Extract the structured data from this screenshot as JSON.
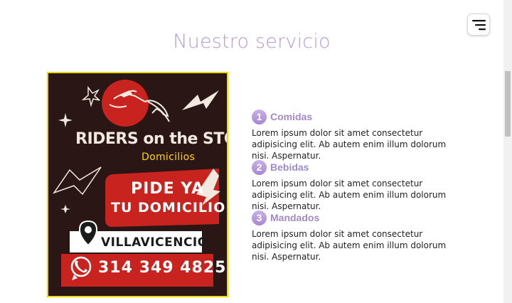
{
  "header": {
    "title": "Nuestro servicio",
    "menu_icon": "menu-icon"
  },
  "poster": {
    "brand": "RIDERS on the STORM",
    "subtitle": "Domicilios",
    "cta_line1": "PIDE YA",
    "cta_line2": "TU DOMICILIO",
    "city": "VILLAVICENCIO",
    "phone": "314 349 4825",
    "icons": [
      "horse-rider-icon",
      "lightning-icon",
      "location-pin-icon",
      "whatsapp-icon"
    ]
  },
  "services": [
    {
      "number": "1",
      "title": "Comidas",
      "text": "Lorem ipsum dolor sit amet consectetur adipisicing elit. Ab autem enim illum dolorum nisi. Aspernatur."
    },
    {
      "number": "2",
      "title": "Bebidas",
      "text": "Lorem ipsum dolor sit amet consectetur adipisicing elit. Ab autem enim illum dolorum nisi. Aspernatur."
    },
    {
      "number": "3",
      "title": "Mandados",
      "text": "Lorem ipsum dolor sit amet consectetur adipisicing elit. Ab autem enim illum dolorum nisi. Aspernatur."
    }
  ],
  "colors": {
    "accent": "#b49bd6",
    "service_title": "#a18ac6",
    "poster_bg": "#2a1715",
    "poster_red": "#c8231e",
    "poster_yellow": "#ffd400"
  }
}
